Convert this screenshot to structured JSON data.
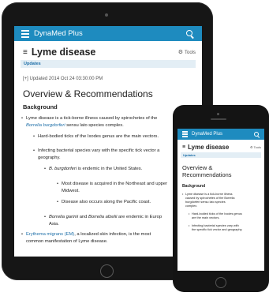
{
  "tablet": {
    "app_name": "DynaMed Plus",
    "title_icon": "≡",
    "title": "Lyme disease",
    "tools_label": "Tools",
    "updates_label": "Updates",
    "updated_text": "[+] Updated 2014 Oct 24 03:30:00 PM",
    "section_title": "Overview & Recommendations",
    "subsection_title": "Background",
    "b1_pre": "Lyme disease is a tick-borne illness caused by spirochetes of the",
    "b1_link": "Borrelia burgdorferi",
    "b1_post": "sensu lato species complex.",
    "b2": "Hard-bodied ticks of the Ixodes genus are the main vectors.",
    "b3_line1": "Infecting bacterial species vary with the specific tick vector a",
    "b3_line2": "geography.",
    "b4_italic": "B. burgdorferi",
    "b4_rest": "is endemic in the United States.",
    "b5_line1": "Most disease is acquired in the Northeast and upper",
    "b5_line2": "Midwest.",
    "b6": "Disease also occurs along the Pacific coast.",
    "b7_italic": "Borrelia garinii",
    "b7_mid": "and",
    "b7_italic2": "Borrelia afzelii",
    "b7_rest": "are endemic in Europ",
    "b7_line2": "Asia.",
    "b8_link": "Erythema migrans (EM)",
    "b8_rest": ", a localized skin infection, is the most",
    "b8_line2": "common manifestation of Lyme disease."
  },
  "phone": {
    "app_name": "DynaMed Plus",
    "title_icon": "≡",
    "title": "Lyme disease",
    "tools_label": "Tools",
    "updates_label": "Updates",
    "section_title_line1": "Overview &",
    "section_title_line2": "Recommendations",
    "subsection_title": "Background",
    "b1_l1": "Lyme disease is a tick-borne illness",
    "b1_l2": "caused by spirochetes of the Borrelia",
    "b1_l3": "burgdorferi sensu lato species",
    "b1_l4": "complex.",
    "b2_l1": "Hard-bodied ticks of the Ixodes genus",
    "b2_l2": "are the main vectors.",
    "b3_l1": "Infecting bacterial species vary with",
    "b3_l2": "the specific tick vector and geography."
  },
  "colors": {
    "header_blue": "#1e8bbf",
    "link_blue": "#1e6fa8",
    "updates_bg": "#e3eef5"
  },
  "icons": [
    "hamburger-menu-icon",
    "search-icon",
    "gear-icon",
    "document-icon"
  ]
}
